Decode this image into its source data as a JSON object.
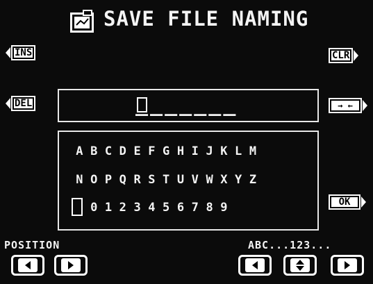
{
  "title": "SAVE FILE NAMING",
  "buttons": {
    "ins": "INS",
    "del": "DEL",
    "clr": "CLR",
    "space": "→ ←",
    "ok": "OK"
  },
  "name_field": {
    "value": "_______"
  },
  "char_rows": [
    [
      "A",
      "B",
      "C",
      "D",
      "E",
      "F",
      "G",
      "H",
      "I",
      "J",
      "K",
      "L",
      "M"
    ],
    [
      "N",
      "O",
      "P",
      "Q",
      "R",
      "S",
      "T",
      "U",
      "V",
      "W",
      "X",
      "Y",
      "Z"
    ],
    [
      " ",
      "0",
      "1",
      "2",
      "3",
      "4",
      "5",
      "6",
      "7",
      "8",
      "9"
    ]
  ],
  "bottom": {
    "position_label": "POSITION",
    "charset_label": "ABC...123..."
  },
  "icons": [
    "save-disk-icon",
    "left-arrow-icon",
    "right-arrow-icon",
    "up-down-arrow-icon"
  ]
}
